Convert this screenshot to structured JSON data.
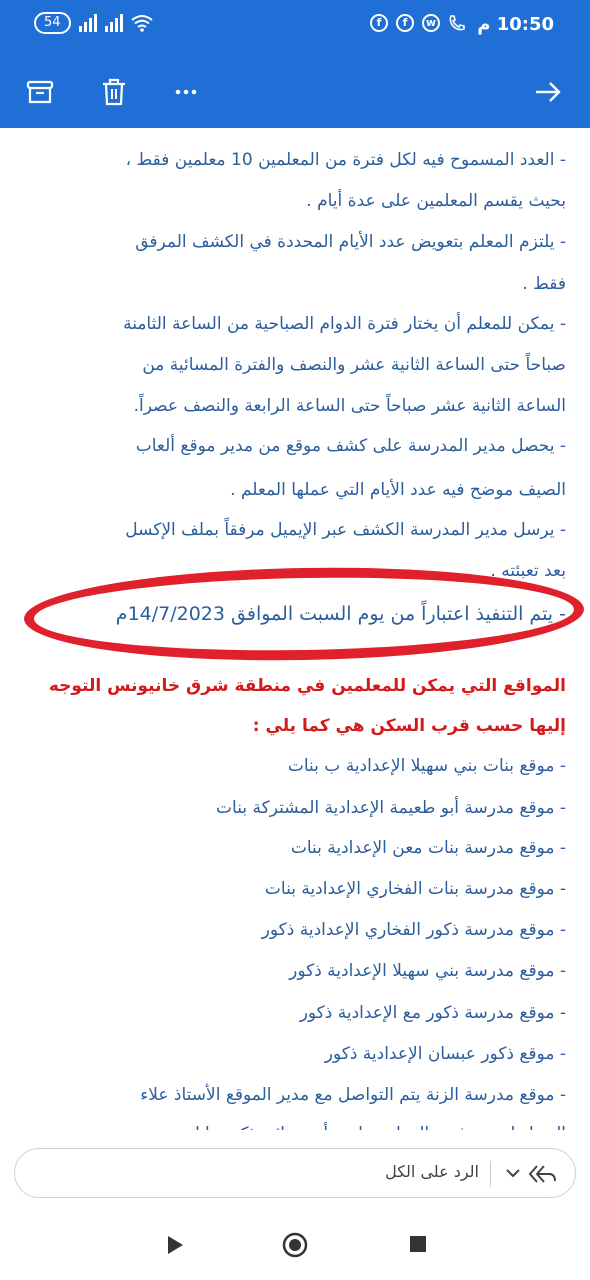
{
  "status_bar": {
    "time": "10:50 م",
    "battery": "54"
  },
  "toolbar": {
    "archive_icon": "archive-icon",
    "delete_icon": "trash-icon",
    "more_icon": "more-icon",
    "forward_icon": "arrow-right-icon"
  },
  "email_body": {
    "lines": [
      "- العدد المسموح فيه لكل فترة من المعلمين 10 معلمين فقط ،",
      "بحيث يقسم المعلمين على عدة أيام .",
      "- يلتزم المعلم بتعويض عدد الأيام المحددة في الكشف المرفق",
      "فقط .",
      "- يمكن للمعلم أن يختار فترة الدوام الصباحية من الساعة الثامنة",
      "صباحاً حتى الساعة الثانية عشر والنصف والفترة المسائية من",
      "الساعة الثانية عشر صباحاً حتى الساعة الرابعة والنصف عصراً.",
      "- يحصل مدير المدرسة على كشف موقع من مدير موقع ألعاب",
      "الصيف موضح فيه عدد الأيام التي عملها المعلم .",
      "- يرسل مدير المدرسة الكشف عبر الإيميل مرفقاً بملف الإكسل",
      "بعد تعبئته .",
      "- يتم التنفيذ اعتباراً من يوم السبت الموافق 14/7/2023م",
      "المواقع التي يمكن للمعلمين في منطقة شرق خانيونس التوجه",
      "إليها حسب قرب السكن هي كما يلي :",
      "- موقع بنات بني سهيلا الإعدادية ب بنات",
      "- موقع مدرسة أبو طعيمة الإعدادية المشتركة  بنات",
      "- موقع مدرسة بنات معن الإعدادية بنات",
      "- موقع مدرسة بنات الفخاري الإعدادية بنات",
      "- موقع مدرسة ذكور الفخاري الإعدادية ذكور",
      "- موقع مدرسة بني سهيلا الإعدادية ذكور",
      "- موقع مدرسة ذكور مع الإعدادية ذكور",
      "- موقع ذكور عبسان الإعدادية ذكور",
      "- موقع مدرسة الزنة يتم التواصل مع مدير الموقع الأستاذ علاء",
      "الحجار لتحديد فترة العمل صباحي أو مسائي ذكور وإناث"
    ]
  },
  "reply_bar": {
    "label": "الرد على الكل"
  },
  "colors": {
    "accent": "#1f6fd6",
    "body_text": "#2c5e9c",
    "heading_red": "#d41b1b",
    "annotation_red": "#e0202a"
  }
}
